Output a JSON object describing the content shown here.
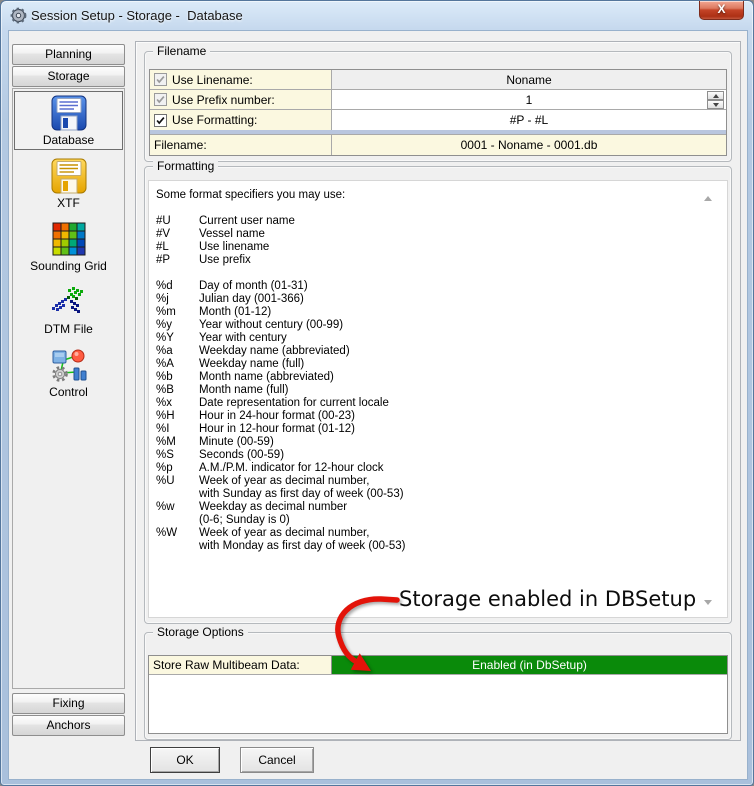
{
  "window": {
    "title": "Session Setup - Storage -  Database",
    "close_glyph": "X"
  },
  "sidebar": {
    "top_buttons": [
      "Planning",
      "Storage"
    ],
    "items": [
      {
        "label": "Database",
        "icon": "database-floppy-icon",
        "selected": true
      },
      {
        "label": "XTF",
        "icon": "xtf-floppy-icon",
        "selected": false
      },
      {
        "label": "Sounding Grid",
        "icon": "sounding-grid-icon",
        "selected": false
      },
      {
        "label": "DTM File",
        "icon": "dtm-file-icon",
        "selected": false
      },
      {
        "label": "Control",
        "icon": "control-icon",
        "selected": false
      }
    ],
    "bottom_buttons": [
      "Fixing",
      "Anchors"
    ]
  },
  "filename_group": {
    "title": "Filename",
    "rows": [
      {
        "label": "Use Linename:",
        "checked": true,
        "enabled": false,
        "value": "Noname",
        "value_muted": true,
        "spinner": false
      },
      {
        "label": "Use Prefix number:",
        "checked": true,
        "enabled": false,
        "value": "1",
        "value_muted": false,
        "spinner": true
      },
      {
        "label": "Use Formatting:",
        "checked": true,
        "enabled": true,
        "value": "#P - #L",
        "value_muted": false,
        "spinner": false
      }
    ],
    "result_row": {
      "label": "Filename:",
      "value": "0001 - Noname - 0001.db"
    }
  },
  "formatting_group": {
    "title": "Formatting",
    "intro": "Some format specifiers you may use:",
    "specifiers": [
      {
        "code": "#U",
        "desc": "Current user name"
      },
      {
        "code": "#V",
        "desc": "Vessel name"
      },
      {
        "code": "#L",
        "desc": "Use linename"
      },
      {
        "code": "#P",
        "desc": "Use prefix"
      },
      {
        "gap": true
      },
      {
        "code": "%d",
        "desc": "Day of month (01-31)"
      },
      {
        "code": "%j",
        "desc": "Julian day (001-366)"
      },
      {
        "code": "%m",
        "desc": "Month (01-12)"
      },
      {
        "code": "%y",
        "desc": "Year without century (00-99)"
      },
      {
        "code": "%Y",
        "desc": "Year with century"
      },
      {
        "code": "%a",
        "desc": "Weekday name (abbreviated)"
      },
      {
        "code": "%A",
        "desc": "Weekday name (full)"
      },
      {
        "code": "%b",
        "desc": "Month name (abbreviated)"
      },
      {
        "code": "%B",
        "desc": "Month name (full)"
      },
      {
        "code": "%x",
        "desc": "Date representation for current locale"
      },
      {
        "code": "%H",
        "desc": "Hour in 24-hour format (00-23)"
      },
      {
        "code": "%I",
        "desc": "Hour in 12-hour format (01-12)"
      },
      {
        "code": "%M",
        "desc": "Minute (00-59)"
      },
      {
        "code": "%S",
        "desc": "Seconds (00-59)"
      },
      {
        "code": "%p",
        "desc": "A.M./P.M. indicator for 12-hour clock"
      },
      {
        "code": "%U",
        "desc": "Week of year as decimal number,"
      },
      {
        "code": "",
        "desc": "with Sunday as first day of week (00-53)"
      },
      {
        "code": "%w",
        "desc": "Weekday as decimal number"
      },
      {
        "code": "",
        "desc": "(0-6; Sunday is 0)"
      },
      {
        "code": "%W",
        "desc": "Week of year as decimal number,"
      },
      {
        "code": "",
        "desc": "with Monday as first day of week (00-53)"
      }
    ]
  },
  "annotation": {
    "text": "Storage enabled in DBSetup"
  },
  "storage_options_group": {
    "title": "Storage Options",
    "row": {
      "label": "Store Raw Multibeam Data:",
      "value": "Enabled (in DbSetup)"
    }
  },
  "footer": {
    "ok_label": "OK",
    "cancel_label": "Cancel"
  },
  "colors": {
    "enabled_green": "#0a8a0a",
    "info_yellow": "#fbf8e0",
    "separator_blue": "#b9c6de",
    "annotation_red": "#e31309"
  }
}
